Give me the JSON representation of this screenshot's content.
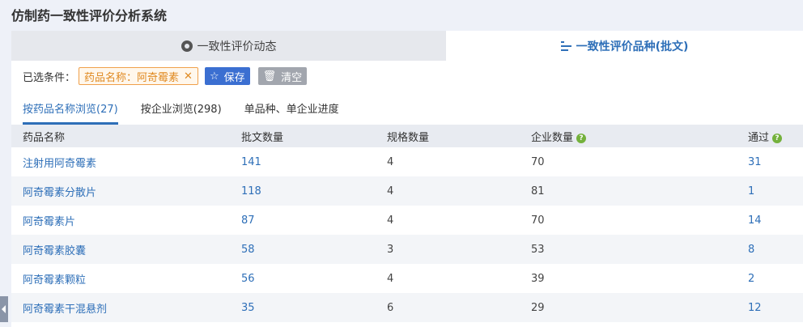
{
  "app": {
    "title": "仿制药一致性评价分析系统"
  },
  "tabs": [
    {
      "label": "一致性评价动态",
      "icon": "circle-target-icon",
      "active": false
    },
    {
      "label": "一致性评价品种(批文)",
      "icon": "list-icon",
      "active": true
    }
  ],
  "filters": {
    "label": "已选条件：",
    "tag": "药品名称：阿奇霉素",
    "tag_close": "✕",
    "save_label": "保存",
    "clear_label": "清空"
  },
  "subtabs": [
    {
      "label": "按药品名称浏览(27)",
      "active": true
    },
    {
      "label": "按企业浏览(298)",
      "active": false
    },
    {
      "label": "单品种、单企业进度",
      "active": false
    }
  ],
  "table": {
    "headers": [
      "药品名称",
      "批文数量",
      "规格数量",
      "企业数量",
      "通过"
    ],
    "rows": [
      [
        "注射用阿奇霉素",
        "141",
        "4",
        "70",
        "31"
      ],
      [
        "阿奇霉素分散片",
        "118",
        "4",
        "81",
        "1"
      ],
      [
        "阿奇霉素片",
        "87",
        "4",
        "70",
        "14"
      ],
      [
        "阿奇霉素胶囊",
        "58",
        "3",
        "53",
        "8"
      ],
      [
        "阿奇霉素颗粒",
        "56",
        "4",
        "39",
        "2"
      ],
      [
        "阿奇霉素干混悬剂",
        "35",
        "6",
        "29",
        "12"
      ]
    ]
  },
  "colors": {
    "accent": "#2e6fb8",
    "tag_orange": "#e08a22",
    "save_blue": "#3b6fd1",
    "clear_gray": "#a2a6ae",
    "help_green": "#74b13c"
  }
}
